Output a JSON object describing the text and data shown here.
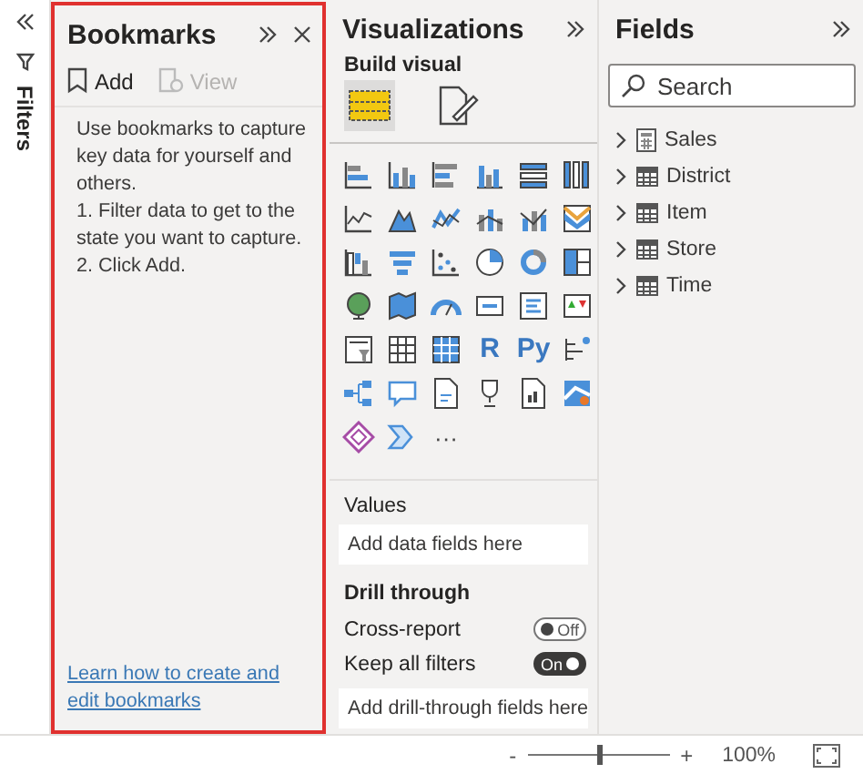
{
  "filters_pane": {
    "title": "Filters"
  },
  "bookmarks": {
    "title": "Bookmarks",
    "toolbar": [
      {
        "label": "Add",
        "disabled": false
      },
      {
        "label": "View",
        "disabled": true
      }
    ],
    "help": "Use bookmarks to capture key data for yourself and others.\n1. Filter data to get to the state you want to capture.\n2. Click Add.",
    "link": "Learn how to create and edit bookmarks"
  },
  "visualizations": {
    "title": "Visualizations",
    "section": "Build visual",
    "build_tabs": [
      {
        "selected": true
      },
      {
        "selected": false
      }
    ],
    "gallery": [
      {
        "kind": "icon"
      },
      {
        "kind": "icon"
      },
      {
        "kind": "icon"
      },
      {
        "kind": "icon"
      },
      {
        "kind": "icon"
      },
      {
        "kind": "icon"
      },
      {
        "kind": "icon"
      },
      {
        "kind": "icon"
      },
      {
        "kind": "icon"
      },
      {
        "kind": "icon"
      },
      {
        "kind": "icon"
      },
      {
        "kind": "icon"
      },
      {
        "kind": "icon"
      },
      {
        "kind": "icon"
      },
      {
        "kind": "icon"
      },
      {
        "kind": "icon"
      },
      {
        "kind": "icon"
      },
      {
        "kind": "icon"
      },
      {
        "kind": "icon"
      },
      {
        "kind": "icon"
      },
      {
        "kind": "icon"
      },
      {
        "kind": "icon"
      },
      {
        "kind": "icon"
      },
      {
        "kind": "icon"
      },
      {
        "kind": "icon"
      },
      {
        "kind": "icon"
      },
      {
        "kind": "icon"
      },
      {
        "kind": "text",
        "label": "R"
      },
      {
        "kind": "text",
        "label": "Py"
      },
      {
        "kind": "icon"
      },
      {
        "kind": "icon"
      },
      {
        "kind": "icon"
      },
      {
        "kind": "icon"
      },
      {
        "kind": "icon"
      },
      {
        "kind": "icon"
      },
      {
        "kind": "icon"
      },
      {
        "kind": "icon"
      },
      {
        "kind": "icon"
      },
      {
        "kind": "more",
        "label": "···"
      }
    ],
    "values_label": "Values",
    "values_placeholder": "Add data fields here",
    "drill_title": "Drill through",
    "toggles": [
      {
        "label": "Cross-report",
        "on": false,
        "state_text": "Off"
      },
      {
        "label": "Keep all filters",
        "on": true,
        "state_text": "On"
      }
    ],
    "drill_placeholder": "Add drill-through fields here"
  },
  "fields": {
    "title": "Fields",
    "search": {
      "placeholder": "Search"
    },
    "tables": [
      {
        "name": "Sales",
        "kind": "measure",
        "expanded": false
      },
      {
        "name": "District",
        "kind": "table",
        "expanded": false
      },
      {
        "name": "Item",
        "kind": "table",
        "expanded": false
      },
      {
        "name": "Store",
        "kind": "table",
        "expanded": false
      },
      {
        "name": "Time",
        "kind": "table",
        "expanded": false
      }
    ]
  },
  "status_bar": {
    "zoom_minus": "-",
    "zoom_plus": "+",
    "level": 0.5,
    "zoom": "100%"
  }
}
